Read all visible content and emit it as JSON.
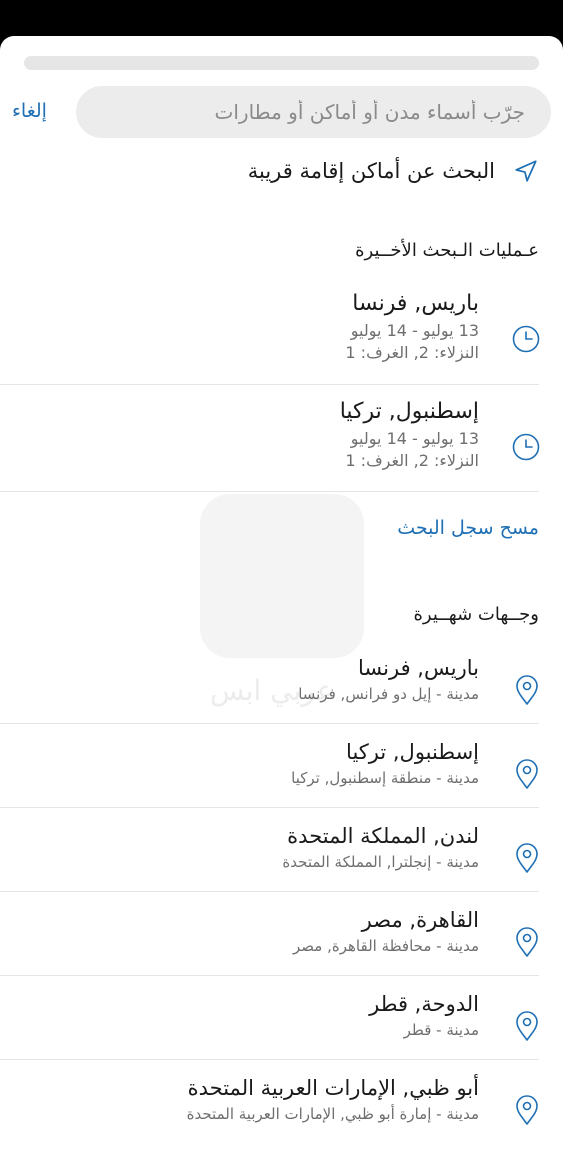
{
  "search": {
    "placeholder": "جرّب أسماء مدن أو أماكن أو مطارات",
    "cancel_label": "إلغاء"
  },
  "nearby": {
    "label": "البحث عن أماكن إقامة قريبة"
  },
  "recent": {
    "title": "عـمليات الـبحث الأخــيرة",
    "items": [
      {
        "title": "باريس, فرنسا",
        "dates": "13 يوليو - 14 يوليو",
        "guests": "النزلاء: 2, الغرف: 1"
      },
      {
        "title": "إسطنبول, تركيا",
        "dates": "13 يوليو - 14 يوليو",
        "guests": "النزلاء: 2, الغرف: 1"
      }
    ],
    "clear_label": "مسح سجل البحث"
  },
  "popular": {
    "title": "وجــهات شهــيرة",
    "items": [
      {
        "title": "باريس, فرنسا",
        "subtitle": "مدينة - إيل دو فرانس, فرنسا"
      },
      {
        "title": "إسطنبول, تركيا",
        "subtitle": "مدينة - منطقة إسطنبول, تركيا"
      },
      {
        "title": "لندن, المملكة المتحدة",
        "subtitle": "مدينة - إنجلترا, المملكة المتحدة"
      },
      {
        "title": "القاهرة, مصر",
        "subtitle": "مدينة - محافظة القاهرة, مصر"
      },
      {
        "title": "الدوحة, قطر",
        "subtitle": "مدينة - قطر"
      },
      {
        "title": "أبو ظبي, الإمارات العربية المتحدة",
        "subtitle": "مدينة - إمارة أبو ظبي, الإمارات العربية المتحدة"
      }
    ]
  },
  "watermark": {
    "text": "عربي ابس"
  },
  "colors": {
    "accent": "#1f6fb5",
    "subtext": "#6e6e6e",
    "search_bg": "#ececec"
  }
}
